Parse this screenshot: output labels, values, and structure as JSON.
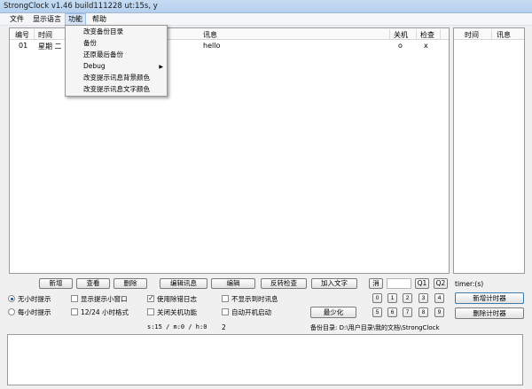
{
  "window": {
    "title": "StrongClock v1.46 build111228 ut:15s, y"
  },
  "menu": {
    "items": [
      "文件",
      "显示语言",
      "功能",
      "帮助"
    ]
  },
  "dropdown": {
    "items": [
      "改变备份目录",
      "备份",
      "还原最后备份",
      "Debug",
      "改变提示讯息背景颜色",
      "改变提示讯息文字颜色"
    ]
  },
  "main_table": {
    "columns": [
      "编号",
      "时间",
      "讯息",
      "关机",
      "检查"
    ],
    "rows": [
      {
        "id": "01",
        "time": "星期 二",
        "message": "hello",
        "shutdown": "o",
        "check": "x"
      }
    ]
  },
  "side_table": {
    "columns": [
      "时间",
      "讯息"
    ]
  },
  "buttons": {
    "add": "新增",
    "view": "查看",
    "delete": "删除",
    "edit_msg": "编辑讯息",
    "edit": "编辑",
    "invert_check": "反转检查",
    "add_text": "加入文字",
    "clear": "消",
    "q1": "Q1",
    "q2": "Q2",
    "add_timer": "新增计时器",
    "delete_timer": "删除计时器",
    "minimize": "最少化"
  },
  "num_buttons": [
    "0",
    "1",
    "2",
    "3",
    "4",
    "5",
    "6",
    "7",
    "8",
    "9"
  ],
  "timer_label": "timer:(s)",
  "options": {
    "radio_none": "无小时提示",
    "radio_hourly": "每小时提示",
    "show_small_window": "显示提示小窗口",
    "format_12_24": "12/24 小时格式",
    "use_log": "使用除错日志",
    "disable_shutdown": "关闭关机功能",
    "hide_reach_msg": "不显示到时讯息",
    "auto_start": "自动开机启动"
  },
  "status": {
    "counter": "s:15 / m:0 / h:0",
    "count": "2",
    "backup_dir": "备份目录: D:\\用户目录\\我的文档\\StrongClock"
  }
}
